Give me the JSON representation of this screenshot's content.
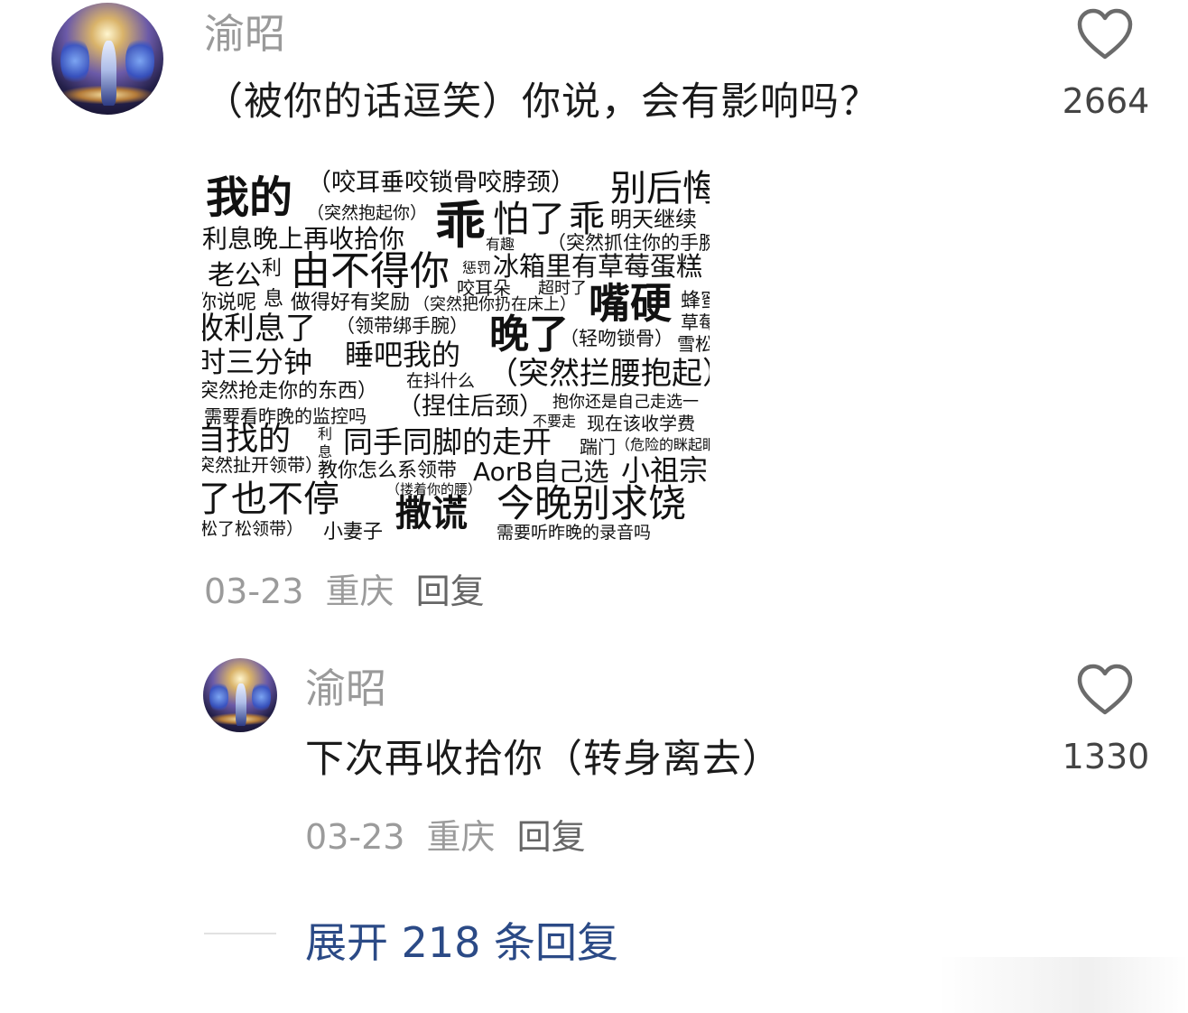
{
  "comment": {
    "username": "渝昭",
    "text": "（被你的话逗笑）你说，会有影响吗？",
    "like_count": "2664",
    "date": "03-23",
    "location": "重庆",
    "reply_label": "回复",
    "image_words": [
      "我的",
      "（咬耳垂咬锁骨咬脖颈）",
      "别后悔",
      "（突然抱起你）",
      "乖",
      "怕了",
      "乖",
      "明天继续",
      "利息晚上再收拾你",
      "有趣",
      "（突然抓住你的手腕",
      "老公",
      "利",
      "由不得你",
      "惩罚",
      "冰箱里有草莓蛋糕",
      "咬耳朵",
      "超时了",
      "嘴硬",
      "蜂蜜",
      "你说呢",
      "息",
      "做得好有奖励",
      "（突然把你扔在床上）",
      "草莓",
      "收利息了",
      "（领带绑手腕）",
      "晚了",
      "（轻吻锁骨）",
      "雪松",
      "时三分钟",
      "睡吧我的",
      "在抖什么",
      "（突然拦腰抱起）",
      "突然抢走你的东西）",
      "（捏住后颈）",
      "抱你还是自己走选一",
      "需要看昨晚的监控吗",
      "不要走",
      "现在该收学费",
      "自找的",
      "利",
      "息",
      "同手同脚的走开",
      "踹门",
      "（危险的眯起眼",
      "突然扯开领带）",
      "教你怎么系领带",
      "AorB自己选",
      "小祖宗",
      "（搂着你的腰）",
      "了也不停",
      "撒谎",
      "今晚别求饶",
      "松了松领带）",
      "小妻子",
      "需要听昨晚的录音吗"
    ]
  },
  "reply": {
    "username": "渝昭",
    "text": "下次再收拾你（转身离去）",
    "like_count": "1330",
    "date": "03-23",
    "location": "重庆",
    "reply_label": "回复"
  },
  "expand_label": "展开 218 条回复",
  "colors": {
    "username": "#9a9a9a",
    "text": "#1b1b1b",
    "meta": "#9b9b9b",
    "link": "#2b4a86"
  }
}
